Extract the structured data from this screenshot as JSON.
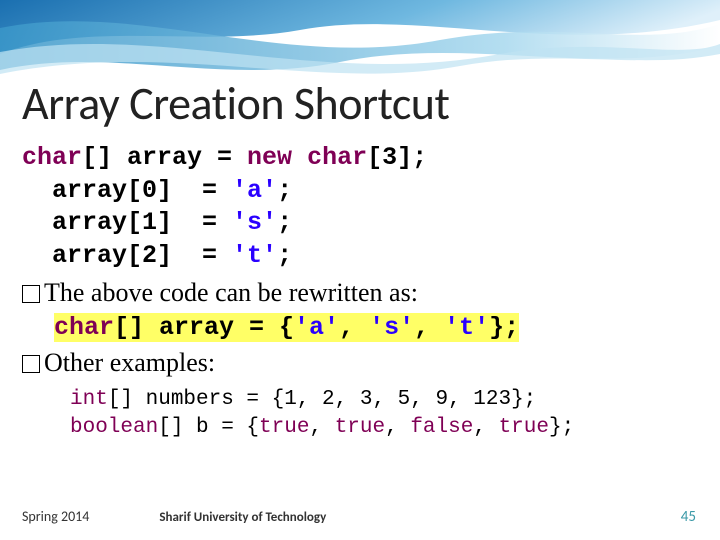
{
  "title": "Array Creation Shortcut",
  "code1": {
    "l1_a": "char",
    "l1_b": "[] array = ",
    "l1_c": "new",
    "l1_d": " ",
    "l1_e": "char",
    "l1_f": "[3];",
    "l2_a": "  array[0]  = ",
    "l2_b": "'a'",
    "l2_c": ";",
    "l3_a": "  array[1]  = ",
    "l3_b": "'s'",
    "l3_c": ";",
    "l4_a": "  array[2]  = ",
    "l4_b": "'t'",
    "l4_c": ";"
  },
  "text1": "The above code can be rewritten as:",
  "code2": {
    "a": "char",
    "b": "[] array = {",
    "c": "'a'",
    "d": ", ",
    "e": "'s'",
    "f": ", ",
    "g": "'t'",
    "h": "};"
  },
  "text2": "Other examples:",
  "code3": {
    "l1_a": "int",
    "l1_b": "[] numbers = {1, 2, 3, 5, 9, 123};",
    "l2_a": "boolean",
    "l2_b": "[] b = {",
    "l2_c": "true",
    "l2_d": ", ",
    "l2_e": "true",
    "l2_f": ", ",
    "l2_g": "false",
    "l2_h": ", ",
    "l2_i": "true",
    "l2_j": "};"
  },
  "footer": {
    "left": "Spring 2014",
    "center": "Sharif University of Technology",
    "right": "45"
  }
}
